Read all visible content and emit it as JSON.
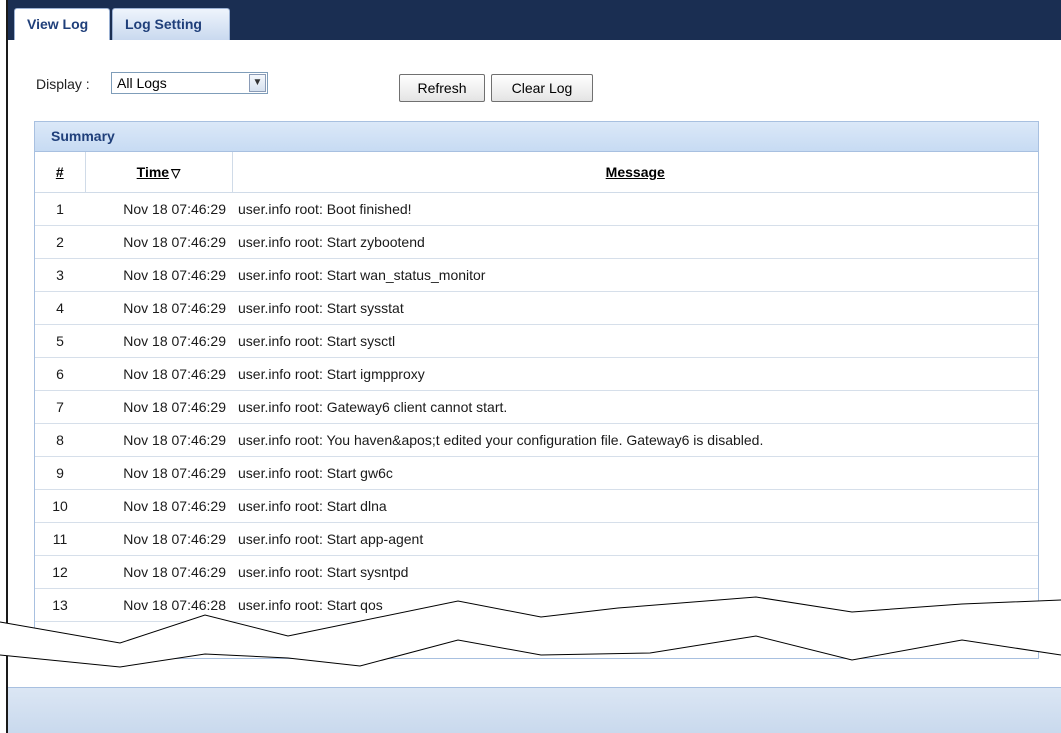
{
  "tabs": [
    {
      "label": "View Log"
    },
    {
      "label": "Log Setting"
    }
  ],
  "toolbar": {
    "display_label": "Display :",
    "display_value": "All Logs",
    "refresh_label": "Refresh",
    "clear_label": "Clear Log"
  },
  "summary": {
    "title": "Summary",
    "columns": {
      "num": "#",
      "time": "Time",
      "message": "Message"
    },
    "rows": [
      {
        "num": "1",
        "time": "Nov 18 07:46:29",
        "message": "user.info root: Boot finished!"
      },
      {
        "num": "2",
        "time": "Nov 18 07:46:29",
        "message": "user.info root: Start zybootend"
      },
      {
        "num": "3",
        "time": "Nov 18 07:46:29",
        "message": "user.info root: Start wan_status_monitor"
      },
      {
        "num": "4",
        "time": "Nov 18 07:46:29",
        "message": "user.info root: Start sysstat"
      },
      {
        "num": "5",
        "time": "Nov 18 07:46:29",
        "message": "user.info root: Start sysctl"
      },
      {
        "num": "6",
        "time": "Nov 18 07:46:29",
        "message": "user.info root: Start igmpproxy"
      },
      {
        "num": "7",
        "time": "Nov 18 07:46:29",
        "message": "user.info root: Gateway6 client cannot start."
      },
      {
        "num": "8",
        "time": "Nov 18 07:46:29",
        "message": "user.info root: You haven&apos;t edited your configuration file. Gateway6 is disabled."
      },
      {
        "num": "9",
        "time": "Nov 18 07:46:29",
        "message": "user.info root: Start gw6c"
      },
      {
        "num": "10",
        "time": "Nov 18 07:46:29",
        "message": "user.info root: Start dlna"
      },
      {
        "num": "11",
        "time": "Nov 18 07:46:29",
        "message": "user.info root: Start app-agent"
      },
      {
        "num": "12",
        "time": "Nov 18 07:46:29",
        "message": "user.info root: Start sysntpd"
      },
      {
        "num": "13",
        "time": "Nov 18 07:46:28",
        "message": "user.info root: Start qos"
      }
    ]
  },
  "icons": {
    "select_arrow": "chevron-down-icon",
    "sort": "sort-desc-icon"
  }
}
